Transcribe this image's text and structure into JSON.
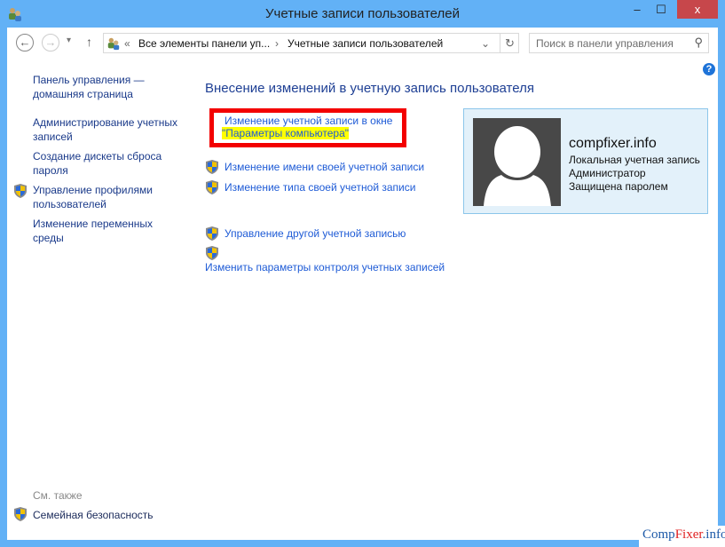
{
  "window": {
    "title": "Учетные записи пользователей",
    "minimize": "–",
    "maximize": "☐",
    "close": "x"
  },
  "nav": {
    "back": "←",
    "forward": "→",
    "recent": "▾",
    "up": "↑",
    "breadcrumb": {
      "prefix": "«",
      "item1": "Все элементы панели уп...",
      "sep": "›",
      "item2": "Учетные записи пользователей"
    },
    "dropdown": "⌄",
    "refresh": "↻",
    "search_placeholder": "Поиск в панели управления",
    "search_icon": "⚲"
  },
  "sidebar": {
    "items": [
      {
        "line1": "Панель управления —",
        "line2": "домашняя страница"
      },
      {
        "line1": "Администрирование учетных",
        "line2": "записей"
      },
      {
        "line1": "Создание дискеты сброса",
        "line2": "пароля"
      },
      {
        "line1": "Управление профилями",
        "line2": "пользователей",
        "icon": "shield-icon"
      },
      {
        "line1": "Изменение переменных",
        "line2": "среды"
      }
    ],
    "see_also": "См. также",
    "family": "Семейная безопасность"
  },
  "main": {
    "title": "Внесение изменений в учетную запись пользователя",
    "links": {
      "pc_settings_1": "Изменение учетной записи в окне",
      "pc_settings_2": "\"Параметры компьютера\"",
      "rename": "Изменение имени своей учетной записи",
      "type": "Изменение типа своей учетной записи",
      "other": "Управление другой учетной записью",
      "uac": "Изменить параметры контроля учетных записей"
    }
  },
  "user": {
    "name": "compfixer.info",
    "type": "Локальная учетная запись",
    "role": "Администратор",
    "password": "Защищена паролем"
  },
  "help": "?",
  "watermark": {
    "a": "Comp",
    "b": "Fixer",
    "c": ".info"
  },
  "colors": {
    "frame": "#62b1f6",
    "link": "#1e5bd6",
    "highlight_box": "#f30000",
    "highlight": "#ffff00"
  }
}
